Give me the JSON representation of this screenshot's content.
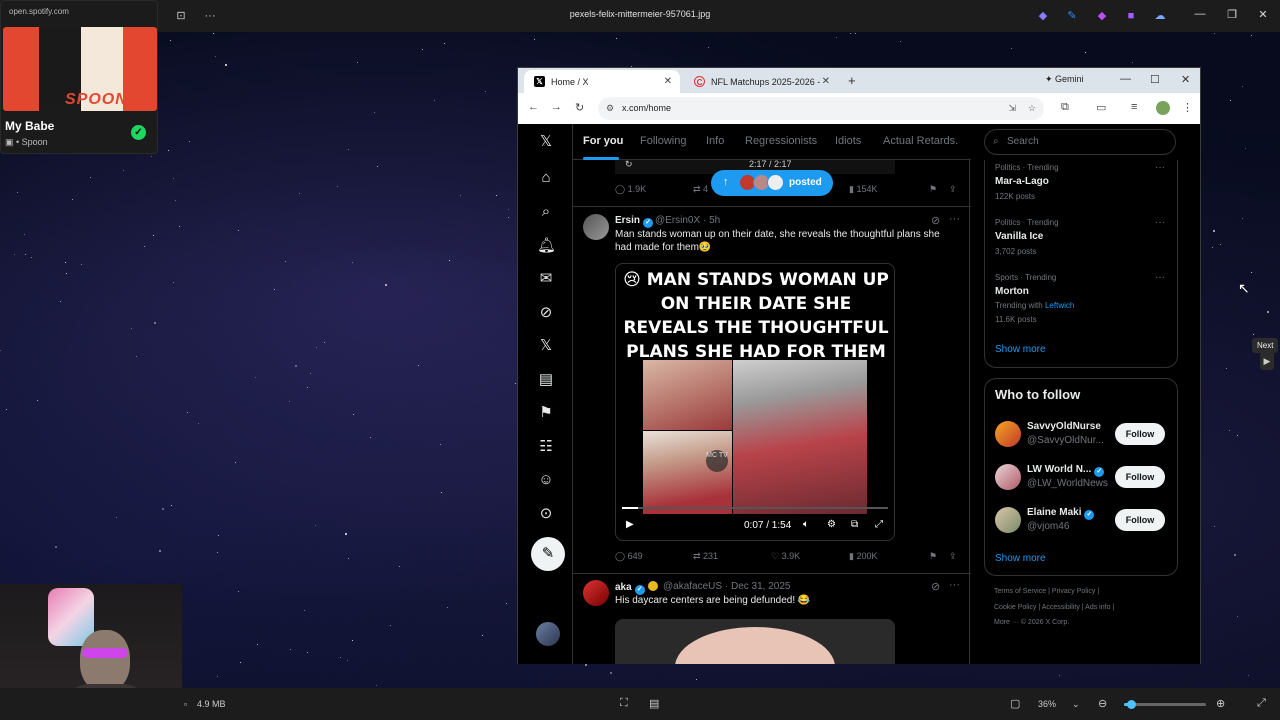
{
  "viewer": {
    "title": "pexels-felix-mittermeier-957061.jpg",
    "file_size": "4.9 MB",
    "zoom": "36%",
    "zoom_level": 0.08,
    "next_tooltip": "Next"
  },
  "spotify": {
    "url": "open.spotify.com",
    "song": "My Babe",
    "artist": "Spoon",
    "album_text": "SPOON"
  },
  "browser": {
    "tabs": [
      {
        "label": "Home / X",
        "active": true
      },
      {
        "label": "NFL Matchups 2025-2026 - Tod",
        "active": false
      }
    ],
    "gemini_label": "Gemini",
    "url": "x.com/home"
  },
  "feed": {
    "tabs": [
      "For you",
      "Following",
      "Info",
      "Regressionists",
      "Idiots",
      "Actual Retards."
    ],
    "prev_post": {
      "video_time": "2:17 / 2:17",
      "replies": "1.9K",
      "reposts": "4",
      "views": "154K"
    },
    "posted_pill": "posted",
    "tweet1": {
      "name": "Ersin",
      "handle": "@Ersin0X",
      "time": "5h",
      "text": "Man stands woman up on their date, she reveals the thoughtful plans she had made for them🥹",
      "video_headline": "😢 MAN STANDS WOMAN UP ON THEIR DATE SHE REVEALS THE THOUGHTFUL PLANS SHE HAD FOR THEM",
      "watermark": "MC TV",
      "video_time": "0:07 / 1:54",
      "progress": 0.06,
      "replies": "649",
      "reposts": "231",
      "likes": "3.9K",
      "views": "200K"
    },
    "tweet2": {
      "name": "aka",
      "handle": "@akafaceUS",
      "time": "Dec 31, 2025",
      "text": "His daycare centers are being defunded! 😂"
    }
  },
  "sidebar": {
    "search_placeholder": "Search",
    "trends": [
      {
        "meta": "Politics · Trending",
        "name": "Mar-a-Lago",
        "posts": "122K posts"
      },
      {
        "meta": "Politics · Trending",
        "name": "Vanilla Ice",
        "posts": "3,702 posts"
      },
      {
        "meta": "Sports · Trending",
        "name": "Morton",
        "with_prefix": "Trending with",
        "with_link": "Leftwich",
        "posts": "11.6K posts"
      }
    ],
    "show_more": "Show more",
    "who_to_follow_title": "Who to follow",
    "who_to_follow": [
      {
        "name": "SavvyOldNurse",
        "handle": "@SavvyOldNur...",
        "verified": false
      },
      {
        "name": "LW World N...",
        "handle": "@LW_WorldNews",
        "verified": true
      },
      {
        "name": "Elaine Maki",
        "handle": "@vjom46",
        "verified": true
      }
    ],
    "follow_label": "Follow",
    "footer": {
      "row1": "Terms of Service  |  Privacy Policy  |",
      "row2": "Cookie Policy  |  Accessibility  |  Ads info  |",
      "row3": "More ···   © 2026 X Corp."
    }
  },
  "colors": {
    "accent": "#1d9bf0",
    "spotify_green": "#1ed760",
    "zoom_accent": "#4cc2ff"
  }
}
